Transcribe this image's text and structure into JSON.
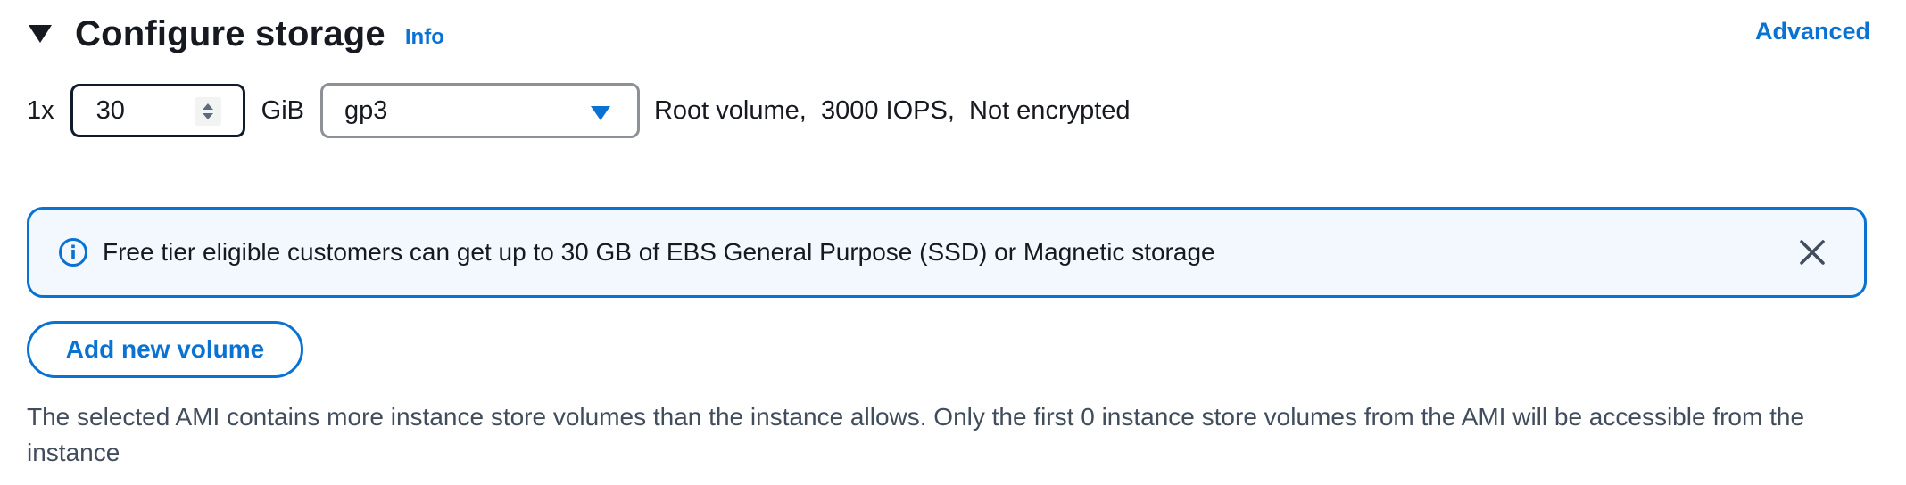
{
  "header": {
    "title": "Configure storage",
    "info_link": "Info",
    "advanced_link": "Advanced",
    "toggle_icon": "caret-down-icon"
  },
  "volume": {
    "multiplier": "1x",
    "size_value": "30",
    "unit": "GiB",
    "type_selected": "gp3",
    "description": "Root volume,  3000 IOPS,  Not encrypted"
  },
  "alert": {
    "icon": "info-icon",
    "text": "Free tier eligible customers can get up to 30 GB of EBS General Purpose (SSD) or Magnetic storage",
    "close_icon": "close-icon"
  },
  "actions": {
    "add_volume_label": "Add new volume"
  },
  "note": {
    "text": "The selected AMI contains more instance store volumes than the instance allows. Only the first 0 instance store volumes from the AMI will be accessible from the instance"
  },
  "colors": {
    "link": "#0972d3",
    "alert_bg": "#f2f8fd",
    "text": "#16191f",
    "muted": "#414d5c"
  }
}
